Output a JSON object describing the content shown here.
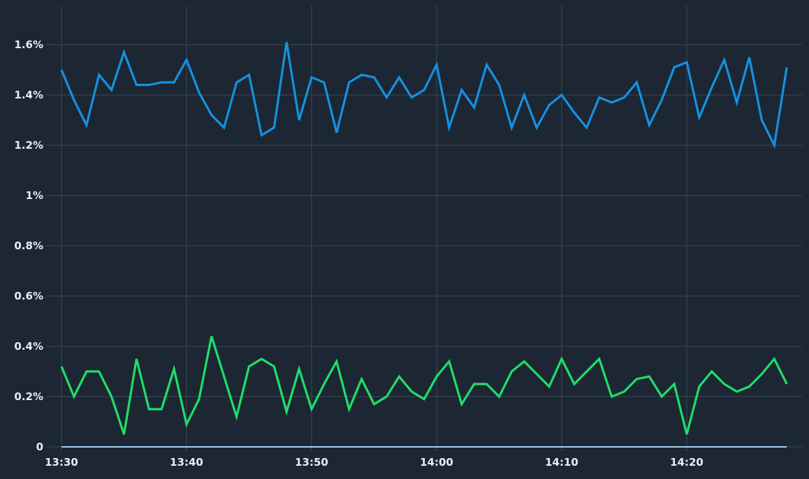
{
  "chart_data": {
    "type": "line",
    "title": "",
    "xlabel": "",
    "ylabel": "",
    "x_start": "13:30",
    "x_step_minutes": 1,
    "x_tick_labels": [
      "13:30",
      "13:40",
      "13:50",
      "14:00",
      "14:10",
      "14:20"
    ],
    "y_tick_labels": [
      "0",
      "0.2%",
      "0.4%",
      "0.6%",
      "0.8%",
      "1%",
      "1.2%",
      "1.4%",
      "1.6%"
    ],
    "ylim": [
      0,
      1.6
    ],
    "ylim_display_max": 1.75,
    "y_unit": "%",
    "grid": true,
    "colors": {
      "background": "#1c2733",
      "grid": "#3a4a58",
      "baseline": "#9fd3f5",
      "tick_text": "#e6edf3"
    },
    "series": [
      {
        "color": "#1591e0",
        "values": [
          1.5,
          1.38,
          1.28,
          1.48,
          1.42,
          1.57,
          1.44,
          1.44,
          1.45,
          1.45,
          1.54,
          1.41,
          1.32,
          1.27,
          1.45,
          1.48,
          1.24,
          1.27,
          1.61,
          1.3,
          1.47,
          1.45,
          1.25,
          1.45,
          1.48,
          1.47,
          1.39,
          1.47,
          1.39,
          1.42,
          1.52,
          1.27,
          1.42,
          1.35,
          1.52,
          1.44,
          1.27,
          1.4,
          1.27,
          1.36,
          1.4,
          1.33,
          1.27,
          1.39,
          1.37,
          1.39,
          1.45,
          1.28,
          1.38,
          1.51,
          1.53,
          1.31,
          1.43,
          1.54,
          1.37,
          1.55,
          1.3,
          1.2,
          1.51
        ]
      },
      {
        "color": "#1fde6a",
        "values": [
          0.32,
          0.2,
          0.3,
          0.3,
          0.2,
          0.05,
          0.35,
          0.15,
          0.15,
          0.31,
          0.09,
          0.19,
          0.44,
          0.28,
          0.12,
          0.32,
          0.35,
          0.32,
          0.14,
          0.31,
          0.15,
          0.25,
          0.34,
          0.15,
          0.27,
          0.17,
          0.2,
          0.28,
          0.22,
          0.19,
          0.28,
          0.34,
          0.17,
          0.25,
          0.25,
          0.2,
          0.3,
          0.34,
          0.29,
          0.24,
          0.35,
          0.25,
          0.3,
          0.35,
          0.2,
          0.22,
          0.27,
          0.28,
          0.2,
          0.25,
          0.05,
          0.24,
          0.3,
          0.25,
          0.22,
          0.24,
          0.29,
          0.35,
          0.25
        ]
      },
      {
        "color": "#9fd3f5",
        "values": [
          0.0,
          0.0,
          0.0,
          0.0,
          0.0,
          0.0,
          0.0,
          0.0,
          0.0,
          0.0,
          0.0,
          0.0,
          0.0,
          0.0,
          0.0,
          0.0,
          0.0,
          0.0,
          0.0,
          0.0,
          0.0,
          0.0,
          0.0,
          0.0,
          0.0,
          0.0,
          0.0,
          0.0,
          0.0,
          0.0,
          0.0,
          0.0,
          0.0,
          0.0,
          0.0,
          0.0,
          0.0,
          0.0,
          0.0,
          0.0,
          0.0,
          0.0,
          0.0,
          0.0,
          0.0,
          0.0,
          0.0,
          0.0,
          0.0,
          0.0,
          0.0,
          0.0,
          0.0,
          0.0,
          0.0,
          0.0,
          0.0,
          0.0,
          0.0
        ]
      }
    ]
  }
}
